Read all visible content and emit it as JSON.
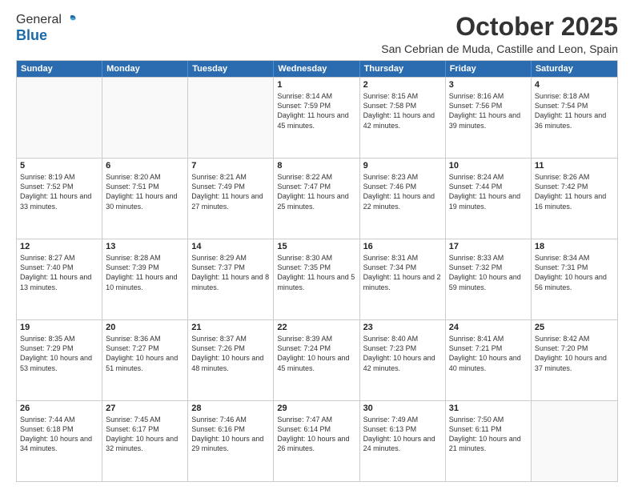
{
  "logo": {
    "line1": "General",
    "line2": "Blue"
  },
  "title": "October 2025",
  "location": "San Cebrian de Muda, Castille and Leon, Spain",
  "header_days": [
    "Sunday",
    "Monday",
    "Tuesday",
    "Wednesday",
    "Thursday",
    "Friday",
    "Saturday"
  ],
  "weeks": [
    [
      {
        "day": "",
        "text": ""
      },
      {
        "day": "",
        "text": ""
      },
      {
        "day": "",
        "text": ""
      },
      {
        "day": "1",
        "text": "Sunrise: 8:14 AM\nSunset: 7:59 PM\nDaylight: 11 hours and 45 minutes."
      },
      {
        "day": "2",
        "text": "Sunrise: 8:15 AM\nSunset: 7:58 PM\nDaylight: 11 hours and 42 minutes."
      },
      {
        "day": "3",
        "text": "Sunrise: 8:16 AM\nSunset: 7:56 PM\nDaylight: 11 hours and 39 minutes."
      },
      {
        "day": "4",
        "text": "Sunrise: 8:18 AM\nSunset: 7:54 PM\nDaylight: 11 hours and 36 minutes."
      }
    ],
    [
      {
        "day": "5",
        "text": "Sunrise: 8:19 AM\nSunset: 7:52 PM\nDaylight: 11 hours and 33 minutes."
      },
      {
        "day": "6",
        "text": "Sunrise: 8:20 AM\nSunset: 7:51 PM\nDaylight: 11 hours and 30 minutes."
      },
      {
        "day": "7",
        "text": "Sunrise: 8:21 AM\nSunset: 7:49 PM\nDaylight: 11 hours and 27 minutes."
      },
      {
        "day": "8",
        "text": "Sunrise: 8:22 AM\nSunset: 7:47 PM\nDaylight: 11 hours and 25 minutes."
      },
      {
        "day": "9",
        "text": "Sunrise: 8:23 AM\nSunset: 7:46 PM\nDaylight: 11 hours and 22 minutes."
      },
      {
        "day": "10",
        "text": "Sunrise: 8:24 AM\nSunset: 7:44 PM\nDaylight: 11 hours and 19 minutes."
      },
      {
        "day": "11",
        "text": "Sunrise: 8:26 AM\nSunset: 7:42 PM\nDaylight: 11 hours and 16 minutes."
      }
    ],
    [
      {
        "day": "12",
        "text": "Sunrise: 8:27 AM\nSunset: 7:40 PM\nDaylight: 11 hours and 13 minutes."
      },
      {
        "day": "13",
        "text": "Sunrise: 8:28 AM\nSunset: 7:39 PM\nDaylight: 11 hours and 10 minutes."
      },
      {
        "day": "14",
        "text": "Sunrise: 8:29 AM\nSunset: 7:37 PM\nDaylight: 11 hours and 8 minutes."
      },
      {
        "day": "15",
        "text": "Sunrise: 8:30 AM\nSunset: 7:35 PM\nDaylight: 11 hours and 5 minutes."
      },
      {
        "day": "16",
        "text": "Sunrise: 8:31 AM\nSunset: 7:34 PM\nDaylight: 11 hours and 2 minutes."
      },
      {
        "day": "17",
        "text": "Sunrise: 8:33 AM\nSunset: 7:32 PM\nDaylight: 10 hours and 59 minutes."
      },
      {
        "day": "18",
        "text": "Sunrise: 8:34 AM\nSunset: 7:31 PM\nDaylight: 10 hours and 56 minutes."
      }
    ],
    [
      {
        "day": "19",
        "text": "Sunrise: 8:35 AM\nSunset: 7:29 PM\nDaylight: 10 hours and 53 minutes."
      },
      {
        "day": "20",
        "text": "Sunrise: 8:36 AM\nSunset: 7:27 PM\nDaylight: 10 hours and 51 minutes."
      },
      {
        "day": "21",
        "text": "Sunrise: 8:37 AM\nSunset: 7:26 PM\nDaylight: 10 hours and 48 minutes."
      },
      {
        "day": "22",
        "text": "Sunrise: 8:39 AM\nSunset: 7:24 PM\nDaylight: 10 hours and 45 minutes."
      },
      {
        "day": "23",
        "text": "Sunrise: 8:40 AM\nSunset: 7:23 PM\nDaylight: 10 hours and 42 minutes."
      },
      {
        "day": "24",
        "text": "Sunrise: 8:41 AM\nSunset: 7:21 PM\nDaylight: 10 hours and 40 minutes."
      },
      {
        "day": "25",
        "text": "Sunrise: 8:42 AM\nSunset: 7:20 PM\nDaylight: 10 hours and 37 minutes."
      }
    ],
    [
      {
        "day": "26",
        "text": "Sunrise: 7:44 AM\nSunset: 6:18 PM\nDaylight: 10 hours and 34 minutes."
      },
      {
        "day": "27",
        "text": "Sunrise: 7:45 AM\nSunset: 6:17 PM\nDaylight: 10 hours and 32 minutes."
      },
      {
        "day": "28",
        "text": "Sunrise: 7:46 AM\nSunset: 6:16 PM\nDaylight: 10 hours and 29 minutes."
      },
      {
        "day": "29",
        "text": "Sunrise: 7:47 AM\nSunset: 6:14 PM\nDaylight: 10 hours and 26 minutes."
      },
      {
        "day": "30",
        "text": "Sunrise: 7:49 AM\nSunset: 6:13 PM\nDaylight: 10 hours and 24 minutes."
      },
      {
        "day": "31",
        "text": "Sunrise: 7:50 AM\nSunset: 6:11 PM\nDaylight: 10 hours and 21 minutes."
      },
      {
        "day": "",
        "text": ""
      }
    ]
  ]
}
